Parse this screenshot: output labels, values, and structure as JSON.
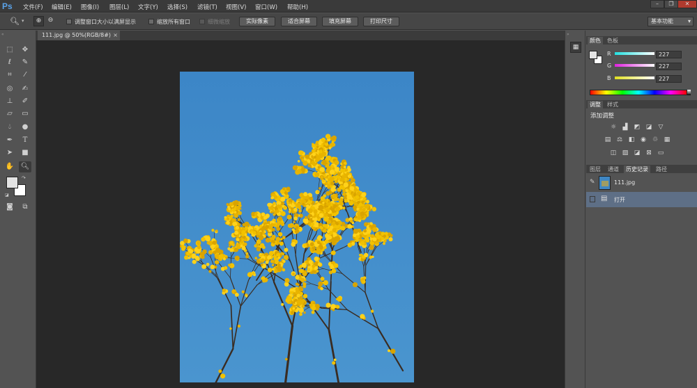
{
  "app": {
    "logo": "Ps"
  },
  "menu": [
    "文件(F)",
    "编辑(E)",
    "图像(I)",
    "图层(L)",
    "文字(Y)",
    "选择(S)",
    "滤镜(T)",
    "视图(V)",
    "窗口(W)",
    "帮助(H)"
  ],
  "options": {
    "resize_windows": "调整窗口大小以满屏显示",
    "zoom_all": "缩放所有窗口",
    "scrubby_zoom": "细微缩放",
    "actual_pixels": "实际像素",
    "fit_screen": "适合屏幕",
    "fill_screen": "填充屏幕",
    "print_size": "打印尺寸",
    "workspace": "基本功能"
  },
  "document": {
    "tab_title": "111.jpg @ 50%(RGB/8#)",
    "close": "×"
  },
  "color_panel": {
    "tabs": [
      "颜色",
      "色板"
    ],
    "r_label": "R",
    "g_label": "G",
    "b_label": "B",
    "r": "227",
    "g": "227",
    "b": "227"
  },
  "adjust_panel": {
    "tabs": [
      "调整",
      "样式"
    ],
    "title": "添加调整"
  },
  "history_panel": {
    "tabs": [
      "图层",
      "通道",
      "历史记录",
      "路径"
    ],
    "snapshot": "111.jpg",
    "step": "打开"
  },
  "colors": {
    "accent": "#5aa2e8",
    "sky": "#3f87c4",
    "blossom": "#f2c200"
  }
}
